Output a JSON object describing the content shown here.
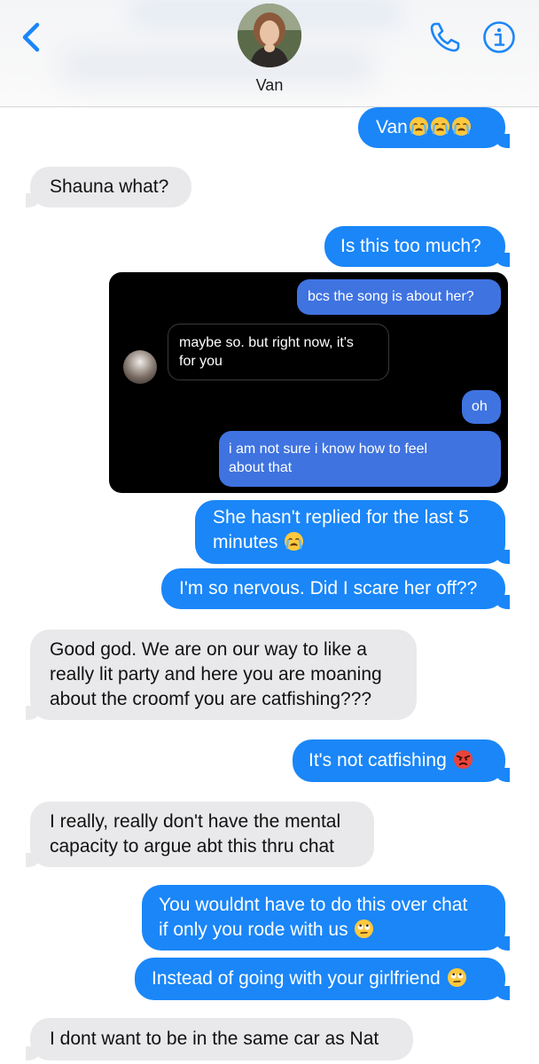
{
  "header": {
    "contact_name": "Van",
    "back_icon": "chevron-left-icon",
    "call_icon": "phone-icon",
    "info_icon": "info-icon",
    "accent": "#1a86f8"
  },
  "messages": [
    {
      "from": "me",
      "text": "Van",
      "emoji": "crying-face x3"
    },
    {
      "from": "them",
      "text": "Shauna what?"
    },
    {
      "from": "me",
      "text": "Is this too much?"
    },
    {
      "from": "me",
      "type": "screenshot"
    },
    {
      "from": "me",
      "text": "She hasn't replied for the last 5"
    },
    {
      "from": "me",
      "text": "minutes",
      "emoji": "crying-face"
    },
    {
      "from": "me",
      "text": "I'm so nervous. Did I scare her off??"
    },
    {
      "from": "them",
      "text": "Good god. We are on our way to like a"
    },
    {
      "from": "them",
      "text": "really lit party and here you are moaning"
    },
    {
      "from": "them",
      "text": "about the croomf you are catfishing???"
    },
    {
      "from": "me",
      "text": "It's not catfishing",
      "emoji": "angry-face"
    },
    {
      "from": "them",
      "text": "I really, really don't have the mental"
    },
    {
      "from": "them",
      "text": "capacity to argue abt this thru chat"
    },
    {
      "from": "me",
      "text": "You wouldnt have to do this over chat"
    },
    {
      "from": "me",
      "text": "if only you rode with us",
      "emoji": "eye-roll-face"
    },
    {
      "from": "me",
      "text": "Instead of going with your girlfriend",
      "emoji": "eye-roll-face"
    },
    {
      "from": "them",
      "text": "I dont want to be in the same car as Nat"
    }
  ],
  "screenshot": {
    "m1": "bcs the song is about her?",
    "m2_line1": "maybe so. but right now, it's",
    "m2_line2": "for you",
    "m3": "oh",
    "m4_line1": "i am not sure i know how to feel",
    "m4_line2": "about that"
  }
}
